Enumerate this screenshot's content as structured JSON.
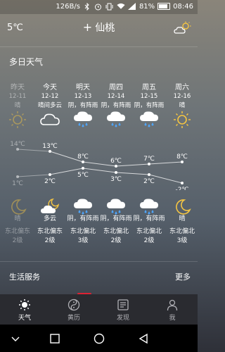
{
  "status": {
    "speed": "126B/s",
    "battery": "81%",
    "battery_level": 0.81,
    "time": "08:46",
    "icons": [
      "bluetooth-icon",
      "alarm-icon",
      "vibrate-icon",
      "wifi-icon",
      "signal-icon",
      "battery-icon"
    ]
  },
  "header": {
    "current_temp": "5℃",
    "city": "仙桃",
    "add_icon": "plus-icon",
    "weather_icon": "cloud-sun-icon"
  },
  "forecast": {
    "title": "多日天气",
    "days": [
      {
        "day": "昨天",
        "date": "12-11",
        "cond": "晴",
        "high": "14℃",
        "low": "1℃",
        "night": "晴",
        "wind": "东北偏东",
        "level": "2级",
        "day_icon": "sun-icon",
        "night_icon": "moon-icon"
      },
      {
        "day": "今天",
        "date": "12-12",
        "cond": "晴间多云",
        "high": "13℃",
        "low": "2℃",
        "night": "多云",
        "wind": "东北偏东",
        "level": "2级",
        "day_icon": "cloud-icon",
        "night_icon": "cloud-moon-icon"
      },
      {
        "day": "明天",
        "date": "12-13",
        "cond": "阴，有阵雨",
        "high": "8℃",
        "low": "5℃",
        "night": "阴，有阵雨",
        "wind": "东北偏北",
        "level": "3级",
        "day_icon": "rain-cloud-icon",
        "night_icon": "rain-cloud-icon"
      },
      {
        "day": "周四",
        "date": "12-14",
        "cond": "阴，有阵雨",
        "high": "6℃",
        "low": "3℃",
        "night": "阴，有阵雨",
        "wind": "东北偏北",
        "level": "2级",
        "day_icon": "rain-cloud-icon",
        "night_icon": "rain-cloud-icon"
      },
      {
        "day": "周五",
        "date": "12-15",
        "cond": "阴，有阵雨",
        "high": "7℃",
        "low": "2℃",
        "night": "阴，有阵雨",
        "wind": "东北偏北",
        "level": "2级",
        "day_icon": "rain-cloud-icon",
        "night_icon": "rain-cloud-icon"
      },
      {
        "day": "周六",
        "date": "12-16",
        "cond": "晴",
        "high": "8℃",
        "low": "-2℃",
        "night": "晴",
        "wind": "东北偏北",
        "level": "3级",
        "day_icon": "sun-icon",
        "night_icon": "moon-icon"
      }
    ]
  },
  "chart_data": {
    "type": "line",
    "categories": [
      "12-11",
      "12-12",
      "12-13",
      "12-14",
      "12-15",
      "12-16"
    ],
    "series": [
      {
        "values": [
          14,
          13,
          8,
          6,
          7,
          8
        ]
      },
      {
        "values": [
          1,
          2,
          5,
          3,
          2,
          -2
        ]
      }
    ]
  },
  "life": {
    "title": "生活服务",
    "more": "更多"
  },
  "tabs": [
    {
      "label": "天气",
      "icon": "sun-tab-icon",
      "active": true
    },
    {
      "label": "黄历",
      "icon": "yin-yang-icon",
      "active": false
    },
    {
      "label": "发现",
      "icon": "news-icon",
      "active": false
    },
    {
      "label": "我",
      "icon": "user-icon",
      "active": false
    }
  ],
  "nav": [
    "chevron-down-icon",
    "square-icon",
    "circle-icon",
    "back-triangle-icon"
  ]
}
